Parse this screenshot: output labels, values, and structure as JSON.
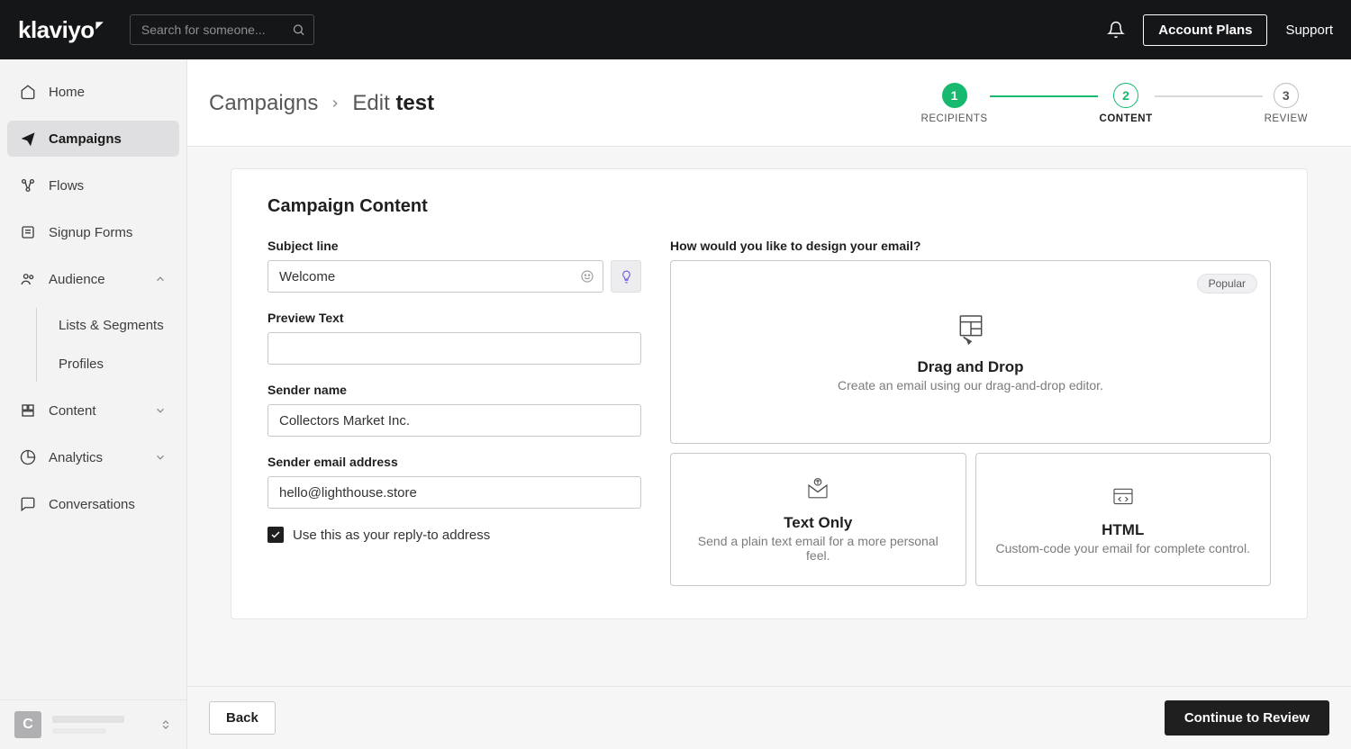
{
  "topbar": {
    "search_placeholder": "Search for someone...",
    "plans_label": "Account Plans",
    "support_label": "Support"
  },
  "sidebar": {
    "items": [
      {
        "label": "Home"
      },
      {
        "label": "Campaigns"
      },
      {
        "label": "Flows"
      },
      {
        "label": "Signup Forms"
      },
      {
        "label": "Audience"
      },
      {
        "label": "Content"
      },
      {
        "label": "Analytics"
      },
      {
        "label": "Conversations"
      }
    ],
    "audience_sub": [
      {
        "label": "Lists & Segments"
      },
      {
        "label": "Profiles"
      }
    ],
    "avatar_initial": "C"
  },
  "breadcrumb": {
    "root": "Campaigns",
    "edit_prefix": "Edit ",
    "edit_name": "test"
  },
  "stepper": {
    "step1": {
      "num": "1",
      "label": "RECIPIENTS"
    },
    "step2": {
      "num": "2",
      "label": "CONTENT"
    },
    "step3": {
      "num": "3",
      "label": "REVIEW"
    }
  },
  "form": {
    "title": "Campaign Content",
    "subject_label": "Subject line",
    "subject_value": "Welcome",
    "preview_label": "Preview Text",
    "preview_value": "",
    "sender_name_label": "Sender name",
    "sender_name_value": "Collectors Market Inc.",
    "sender_email_label": "Sender email address",
    "sender_email_value": "hello@lighthouse.store",
    "reply_to_label": "Use this as your reply-to address"
  },
  "design": {
    "heading": "How would you like to design your email?",
    "popular_badge": "Popular",
    "option1_title": "Drag and Drop",
    "option1_desc": "Create an email using our drag-and-drop editor.",
    "option2_title": "Text Only",
    "option2_desc": "Send a plain text email for a more personal feel.",
    "option3_title": "HTML",
    "option3_desc": "Custom-code your email for complete control."
  },
  "footer": {
    "back_label": "Back",
    "continue_label": "Continue to Review"
  }
}
